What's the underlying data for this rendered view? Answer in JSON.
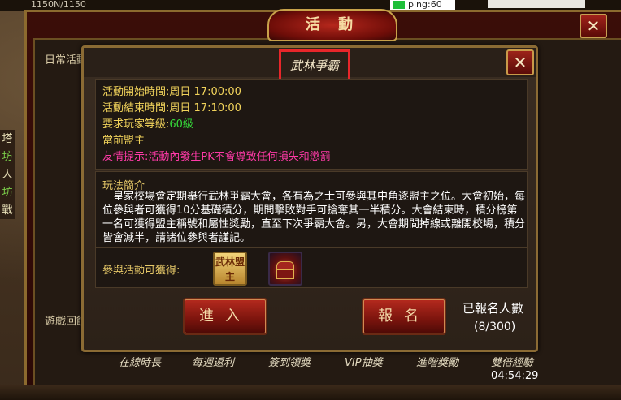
{
  "topbar": {
    "hp": "1150N/1150",
    "ping": "ping:60"
  },
  "window": {
    "title": "活 動",
    "close_icon": "✕",
    "side_labels": {
      "daily": "日常活動",
      "game": "遊戲回饋"
    }
  },
  "dialog": {
    "title": "武林爭霸",
    "close_icon": "✕",
    "info": {
      "start_label": "活動開始時間:",
      "start_value": "周日  17:00:00",
      "end_label": "活動結束時間:",
      "end_value": "周日  17:10:00",
      "level_label": "要求玩家等級:",
      "level_value": "60級",
      "leader_label": "當前盟主",
      "warning": "友情提示:活動內發生PK不會導致任何損失和懲罰"
    },
    "rules": {
      "title": "玩法簡介",
      "text": "　皇家校場會定期舉行武林爭霸大會，各有為之士可參與其中角逐盟主之位。大會初始，每位參與者可獲得10分基礎積分，期間擊敗對手可搶奪其一半積分。大會結束時，積分榜第一名可獲得盟主稱號和屬性獎勵，直至下次爭霸大會。另，大會期間掉線或離開校場，積分皆會減半，請諸位參與者謹記。"
    },
    "rewards": {
      "label": "參與活動可獲得:",
      "book_text": "武林盟主"
    },
    "buttons": {
      "enter": "進入",
      "signup": "報名"
    },
    "signup_count_label": "已報名人數",
    "signup_count": "(8/300)"
  },
  "tabs": [
    "在線時長",
    "每週返利",
    "簽到領獎",
    "VIP抽獎",
    "進階獎勵",
    "雙倍經驗"
  ],
  "timer": "04:54:29",
  "left_hud": [
    "塔",
    "坊",
    "人",
    "坊",
    "戰"
  ]
}
